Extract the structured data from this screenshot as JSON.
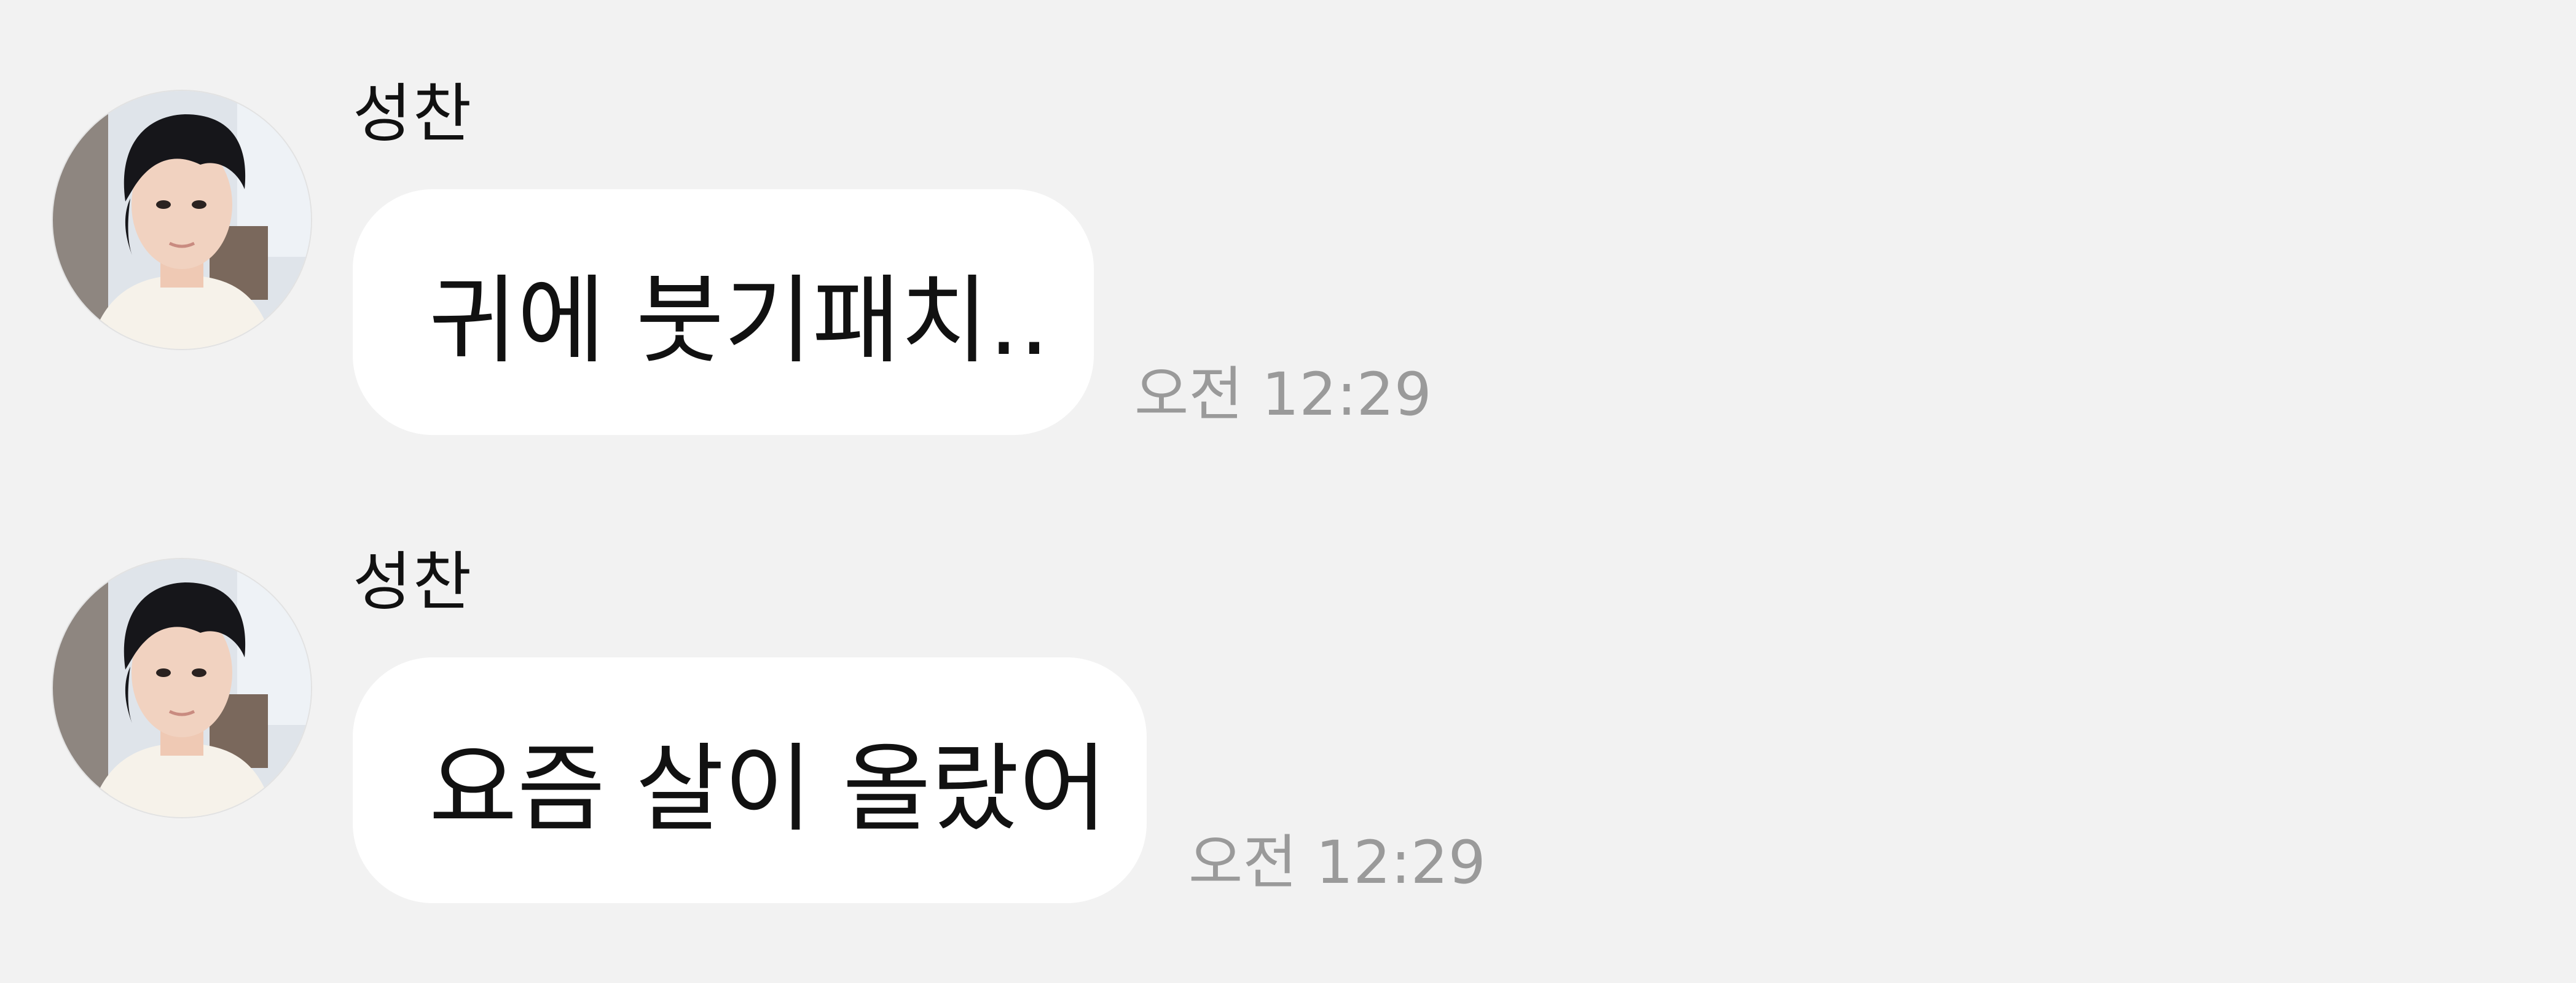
{
  "colors": {
    "background": "#f2f2f2",
    "bubble": "#ffffff",
    "message_text": "#111111",
    "timestamp_text": "#9a9a9a"
  },
  "messages": [
    {
      "sender": "성찬",
      "avatar": "profile-photo-avatar",
      "text": "귀에 붓기패치..",
      "time": "오전 12:29"
    },
    {
      "sender": "성찬",
      "avatar": "profile-photo-avatar",
      "text": "요즘 살이 올랐어",
      "time": "오전 12:29"
    }
  ]
}
